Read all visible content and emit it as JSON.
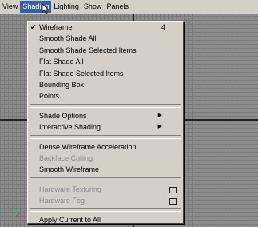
{
  "menubar": {
    "items": [
      "View",
      "Shading",
      "Lighting",
      "Show",
      "Panels"
    ],
    "active_index": 1
  },
  "shading_menu": {
    "groups": [
      [
        {
          "label": "Wireframe",
          "checked": true,
          "shortcut": "4"
        },
        {
          "label": "Smooth Shade All"
        },
        {
          "label": "Smooth Shade Selected Items"
        },
        {
          "label": "Flat Shade All"
        },
        {
          "label": "Flat Shade Selected Items"
        },
        {
          "label": "Bounding Box"
        },
        {
          "label": "Points"
        }
      ],
      [
        {
          "label": "Shade Options",
          "submenu": true
        },
        {
          "label": "Interactive Shading",
          "submenu": true
        }
      ],
      [
        {
          "label": "Dense Wireframe Acceleration"
        },
        {
          "label": "Backface Culling",
          "disabled": true
        },
        {
          "label": "Smooth Wireframe"
        }
      ],
      [
        {
          "label": "Hardware Texturing",
          "disabled": true,
          "option_box": true
        },
        {
          "label": "Hardware Fog",
          "disabled": true,
          "option_box": true
        }
      ],
      [
        {
          "label": "Apply Current to All"
        }
      ]
    ]
  },
  "icons": {
    "checkmark": "check-icon",
    "submenu": "submenu-arrow-icon",
    "option_box": "option-box-icon",
    "cursor": "mouse-pointer-icon",
    "axes": "origin-axes-icon"
  },
  "colors": {
    "menu_bg": "#d4d0c8",
    "highlight": "#3a5fa0",
    "viewport_bg": "#8c8c8c",
    "grid": "#7a7a7a",
    "disabled_text": "#8a8a8a"
  }
}
